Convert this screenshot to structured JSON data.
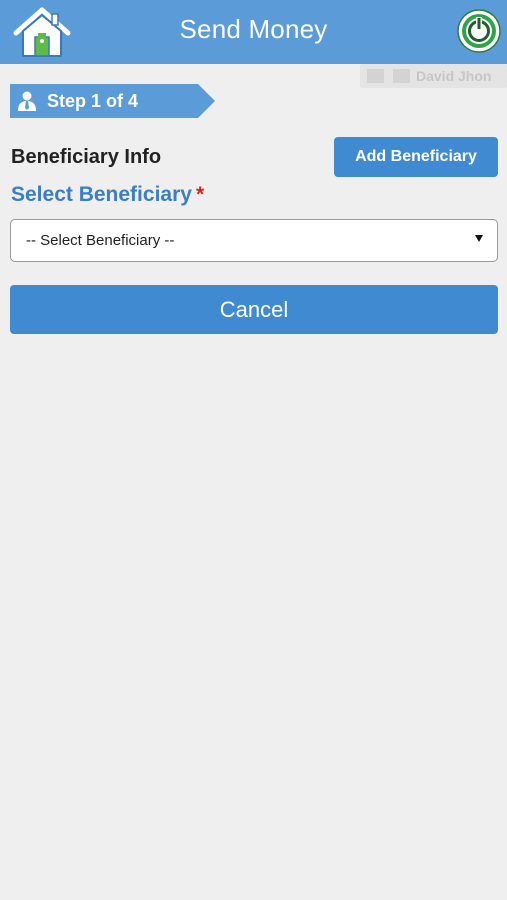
{
  "header": {
    "title": "Send Money",
    "home_icon": "home-icon",
    "power_icon": "power-icon"
  },
  "user": {
    "name": "David Jhon"
  },
  "step": {
    "label": "Step 1 of 4",
    "icon": "user-tie-icon"
  },
  "section": {
    "title": "Beneficiary Info",
    "add_button_label": "Add Beneficiary"
  },
  "beneficiary_select": {
    "label": "Select Beneficiary",
    "required_mark": "*",
    "selected_value": "-- Select Beneficiary --"
  },
  "actions": {
    "cancel_label": "Cancel"
  },
  "colors": {
    "header_bg": "#5b9bd8",
    "button_bg": "#3f8ad0",
    "label_blue": "#3a7fc3",
    "required_red": "#e0201c",
    "page_bg": "#efefef"
  }
}
